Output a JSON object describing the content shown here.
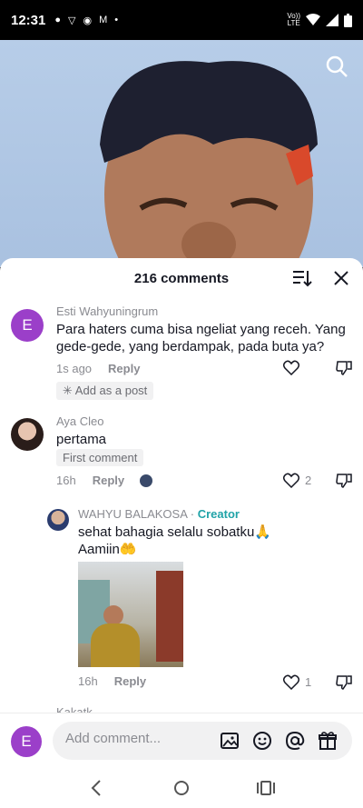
{
  "status_bar": {
    "time": "12:31",
    "network": "Vo))\nLTE"
  },
  "sheet": {
    "title": "216 comments"
  },
  "comments": [
    {
      "avatar_letter": "E",
      "username": "Esti Wahyuningrum",
      "text": "Para haters cuma bisa ngeliat yang receh. Yang gede-gede, yang berdampak, pada buta ya?",
      "time": "1s ago",
      "reply_label": "Reply",
      "action": "Add as a post"
    },
    {
      "username": "Aya Cleo",
      "text": "pertama",
      "tag": "First comment",
      "time": "16h",
      "reply_label": "Reply",
      "likes": "2"
    }
  ],
  "reply": {
    "username": "WAHYU BALAKOSA",
    "separator": " · ",
    "creator_label": "Creator",
    "text_line1": "sehat bahagia selalu sobatku🙏",
    "text_line2": "Aamiin🤲",
    "time": "16h",
    "reply_label": "Reply",
    "likes": "1"
  },
  "partial_next": {
    "username": "Kakatk..."
  },
  "input": {
    "avatar_letter": "E",
    "placeholder": "Add comment..."
  },
  "colors": {
    "avatar_purple": "#9b3fc9",
    "creator_teal": "#20a3a8"
  }
}
